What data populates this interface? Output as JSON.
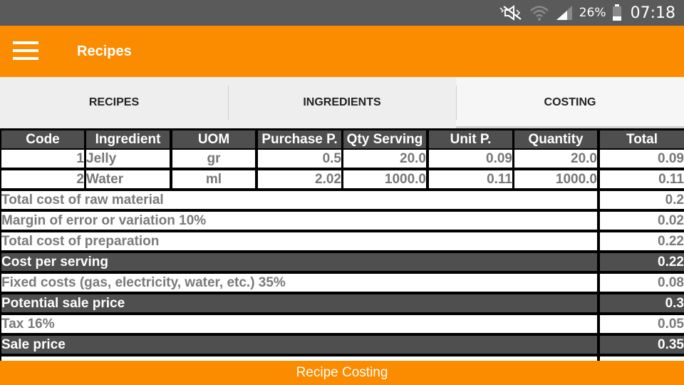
{
  "status_bar": {
    "icons": [
      "mute-icon",
      "wifi-icon",
      "signal-icon",
      "battery-icon"
    ],
    "battery": "26%",
    "time": "07:18"
  },
  "app_bar": {
    "menu_icon": "hamburger-menu-icon",
    "title": "Recipes",
    "color": "#fb8c00"
  },
  "tabs": [
    {
      "label": "RECIPES",
      "active": false
    },
    {
      "label": "INGREDIENTS",
      "active": false
    },
    {
      "label": "COSTING",
      "active": true
    }
  ],
  "costing": {
    "columns": [
      "Code",
      "Ingredient",
      "UOM",
      "Purchase P.",
      "Qty Serving",
      "Unit P.",
      "Quantity",
      "Total"
    ],
    "rows": [
      {
        "code": "1",
        "ingredient": "Jelly",
        "uom": "gr",
        "purchase_price": "0.5",
        "qty_serving": "20.0",
        "unit_price": "0.09",
        "quantity": "20.0",
        "total": "0.09"
      },
      {
        "code": "2",
        "ingredient": "Water",
        "uom": "ml",
        "purchase_price": "2.02",
        "qty_serving": "1000.0",
        "unit_price": "0.11",
        "quantity": "1000.0",
        "total": "0.11"
      }
    ],
    "summary": [
      {
        "label": "Total cost of raw material",
        "value": "0.2",
        "highlight": false
      },
      {
        "label": "Margin of error or variation 10%",
        "value": "0.02",
        "highlight": false
      },
      {
        "label": "Total cost of preparation",
        "value": "0.22",
        "highlight": false
      },
      {
        "label": "Cost per serving",
        "value": "0.22",
        "highlight": true
      },
      {
        "label": "Fixed costs (gas, electricity, water, etc.) 35%",
        "value": "0.08",
        "highlight": false
      },
      {
        "label": "Potential sale price",
        "value": "0.3",
        "highlight": true
      },
      {
        "label": "Tax 16%",
        "value": "0.05",
        "highlight": false
      },
      {
        "label": "Sale price",
        "value": "0.35",
        "highlight": true
      }
    ]
  },
  "bottom_button": {
    "label": "Recipe Costing"
  }
}
